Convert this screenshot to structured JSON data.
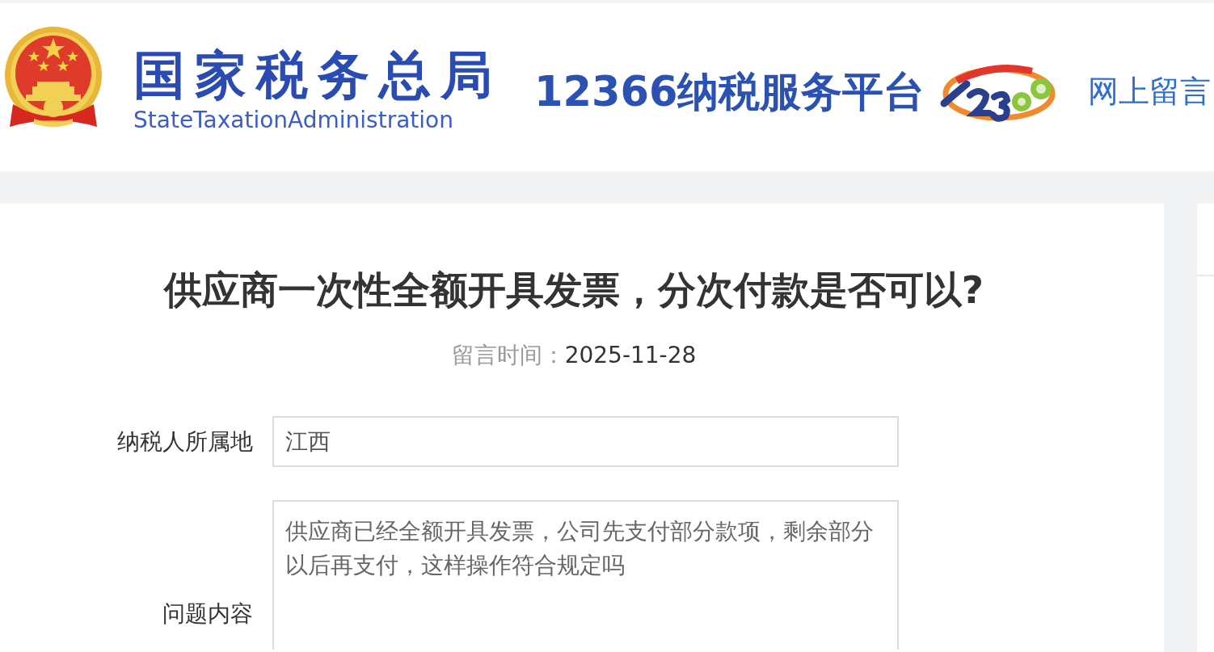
{
  "header": {
    "agency_name": "国家税务总局",
    "agency_name_en": "StateTaxationAdministration",
    "platform_name": "12366纳税服务平台",
    "nav_link": "网上留言"
  },
  "message": {
    "title": "供应商一次性全额开具发票，分次付款是否可以?",
    "time_label": "留言时间：",
    "time": "2025-11-28",
    "fields": [
      {
        "kind": "input",
        "label": "纳税人所属地",
        "value": "江西"
      },
      {
        "kind": "textarea",
        "label": "问题内容",
        "value": "供应商已经全额开具发票，公司先支付部分款项，剩余部分以后再支付，这样操作符合规定吗"
      }
    ]
  }
}
